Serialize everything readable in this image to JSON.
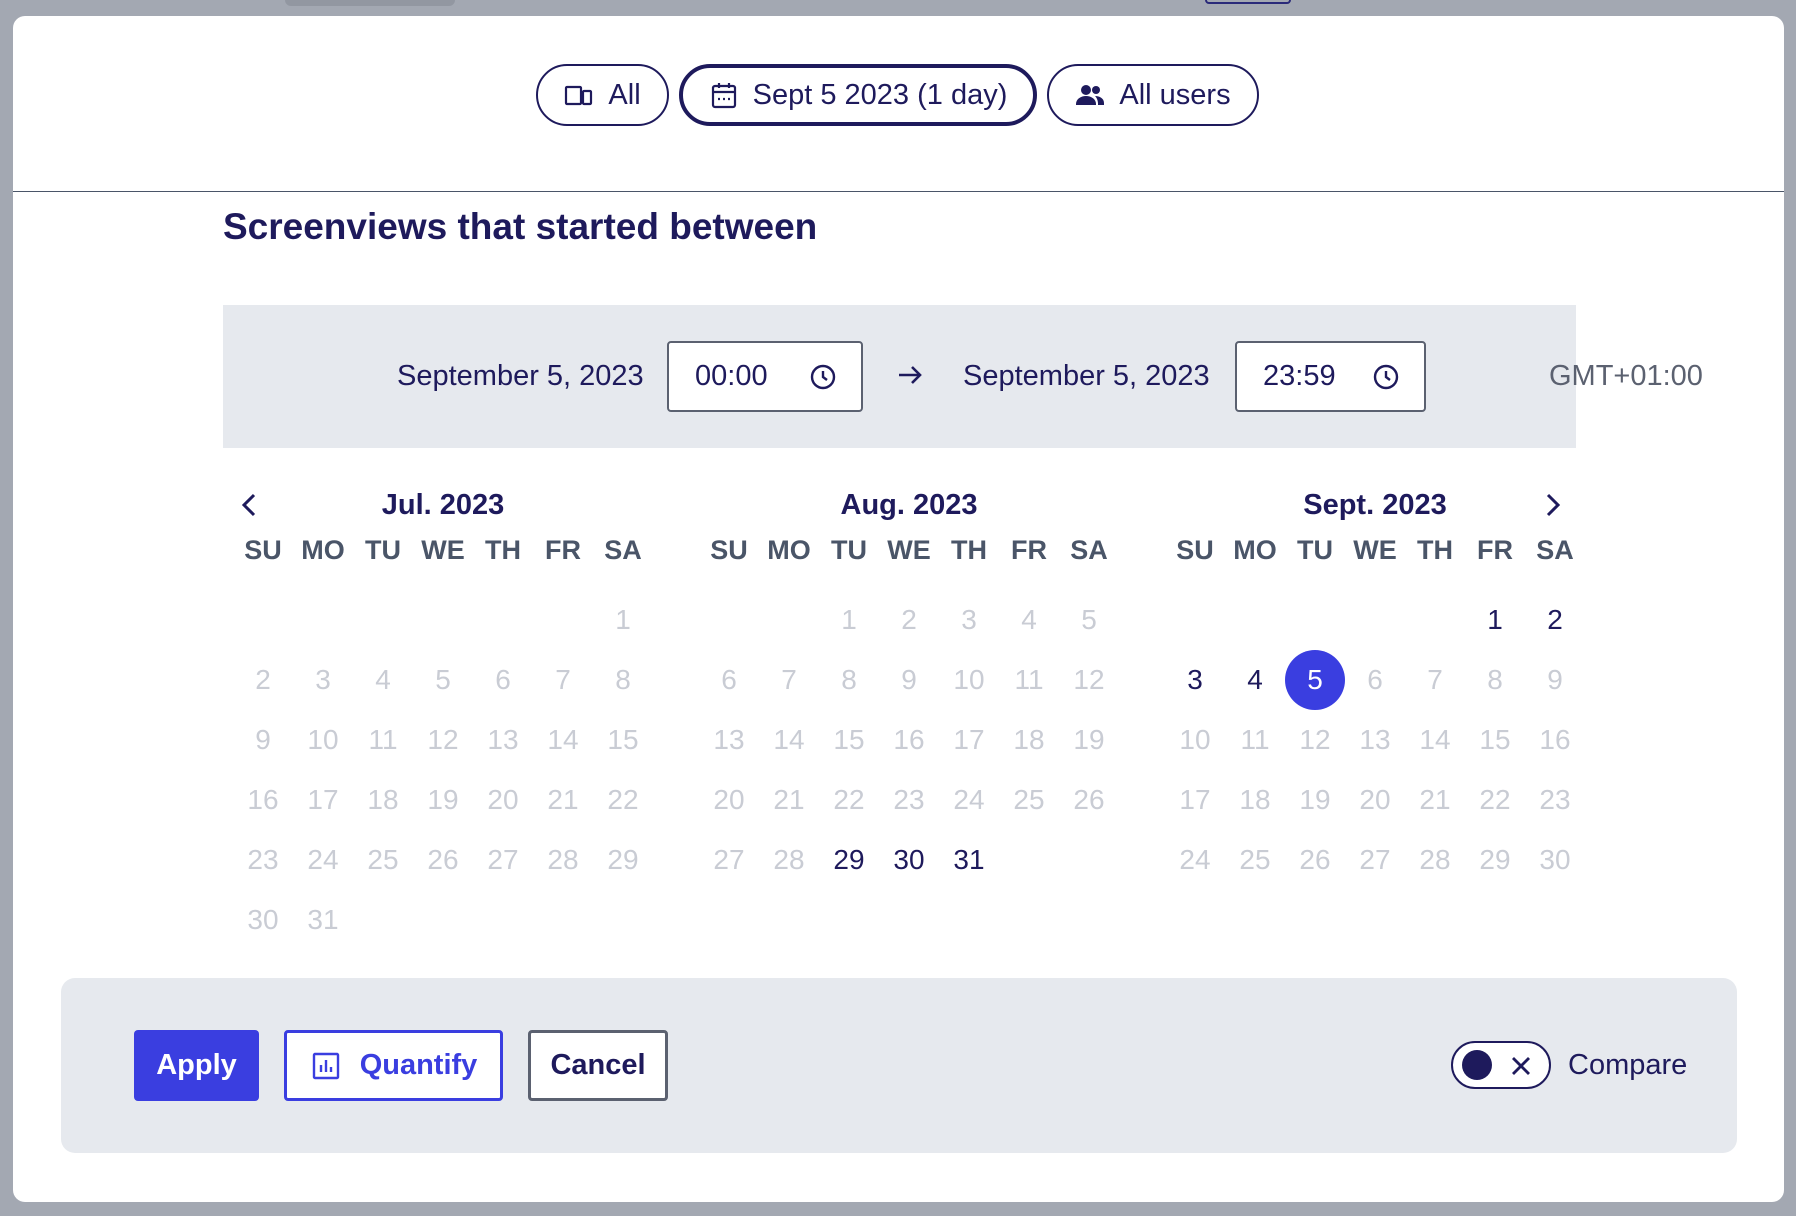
{
  "filters": {
    "device_label": "All",
    "date_label": "Sept 5 2023 (1 day)",
    "users_label": "All users"
  },
  "section_title": "Screenviews that started between",
  "range": {
    "start_date": "September 5, 2023",
    "start_time": "00:00",
    "end_date": "September 5, 2023",
    "end_time": "23:59",
    "timezone": "GMT+01:00"
  },
  "weekdays": [
    "SU",
    "MO",
    "TU",
    "WE",
    "TH",
    "FR",
    "SA"
  ],
  "months": [
    {
      "title": "Jul. 2023",
      "days": [
        {
          "label": "",
          "state": "empty"
        },
        {
          "label": "",
          "state": "empty"
        },
        {
          "label": "",
          "state": "empty"
        },
        {
          "label": "",
          "state": "empty"
        },
        {
          "label": "",
          "state": "empty"
        },
        {
          "label": "",
          "state": "empty"
        },
        {
          "label": "1",
          "state": "disabled"
        },
        {
          "label": "2",
          "state": "disabled"
        },
        {
          "label": "3",
          "state": "disabled"
        },
        {
          "label": "4",
          "state": "disabled"
        },
        {
          "label": "5",
          "state": "disabled"
        },
        {
          "label": "6",
          "state": "disabled"
        },
        {
          "label": "7",
          "state": "disabled"
        },
        {
          "label": "8",
          "state": "disabled"
        },
        {
          "label": "9",
          "state": "disabled"
        },
        {
          "label": "10",
          "state": "disabled"
        },
        {
          "label": "11",
          "state": "disabled"
        },
        {
          "label": "12",
          "state": "disabled"
        },
        {
          "label": "13",
          "state": "disabled"
        },
        {
          "label": "14",
          "state": "disabled"
        },
        {
          "label": "15",
          "state": "disabled"
        },
        {
          "label": "16",
          "state": "disabled"
        },
        {
          "label": "17",
          "state": "disabled"
        },
        {
          "label": "18",
          "state": "disabled"
        },
        {
          "label": "19",
          "state": "disabled"
        },
        {
          "label": "20",
          "state": "disabled"
        },
        {
          "label": "21",
          "state": "disabled"
        },
        {
          "label": "22",
          "state": "disabled"
        },
        {
          "label": "23",
          "state": "disabled"
        },
        {
          "label": "24",
          "state": "disabled"
        },
        {
          "label": "25",
          "state": "disabled"
        },
        {
          "label": "26",
          "state": "disabled"
        },
        {
          "label": "27",
          "state": "disabled"
        },
        {
          "label": "28",
          "state": "disabled"
        },
        {
          "label": "29",
          "state": "disabled"
        },
        {
          "label": "30",
          "state": "disabled"
        },
        {
          "label": "31",
          "state": "disabled"
        }
      ]
    },
    {
      "title": "Aug. 2023",
      "days": [
        {
          "label": "",
          "state": "empty"
        },
        {
          "label": "",
          "state": "empty"
        },
        {
          "label": "1",
          "state": "disabled"
        },
        {
          "label": "2",
          "state": "disabled"
        },
        {
          "label": "3",
          "state": "disabled"
        },
        {
          "label": "4",
          "state": "disabled"
        },
        {
          "label": "5",
          "state": "disabled"
        },
        {
          "label": "6",
          "state": "disabled"
        },
        {
          "label": "7",
          "state": "disabled"
        },
        {
          "label": "8",
          "state": "disabled"
        },
        {
          "label": "9",
          "state": "disabled"
        },
        {
          "label": "10",
          "state": "disabled"
        },
        {
          "label": "11",
          "state": "disabled"
        },
        {
          "label": "12",
          "state": "disabled"
        },
        {
          "label": "13",
          "state": "disabled"
        },
        {
          "label": "14",
          "state": "disabled"
        },
        {
          "label": "15",
          "state": "disabled"
        },
        {
          "label": "16",
          "state": "disabled"
        },
        {
          "label": "17",
          "state": "disabled"
        },
        {
          "label": "18",
          "state": "disabled"
        },
        {
          "label": "19",
          "state": "disabled"
        },
        {
          "label": "20",
          "state": "disabled"
        },
        {
          "label": "21",
          "state": "disabled"
        },
        {
          "label": "22",
          "state": "disabled"
        },
        {
          "label": "23",
          "state": "disabled"
        },
        {
          "label": "24",
          "state": "disabled"
        },
        {
          "label": "25",
          "state": "disabled"
        },
        {
          "label": "26",
          "state": "disabled"
        },
        {
          "label": "27",
          "state": "disabled"
        },
        {
          "label": "28",
          "state": "disabled"
        },
        {
          "label": "29",
          "state": "enabled"
        },
        {
          "label": "30",
          "state": "enabled"
        },
        {
          "label": "31",
          "state": "enabled"
        }
      ]
    },
    {
      "title": "Sept. 2023",
      "days": [
        {
          "label": "",
          "state": "empty"
        },
        {
          "label": "",
          "state": "empty"
        },
        {
          "label": "",
          "state": "empty"
        },
        {
          "label": "",
          "state": "empty"
        },
        {
          "label": "",
          "state": "empty"
        },
        {
          "label": "1",
          "state": "enabled"
        },
        {
          "label": "2",
          "state": "enabled"
        },
        {
          "label": "3",
          "state": "enabled"
        },
        {
          "label": "4",
          "state": "enabled"
        },
        {
          "label": "5",
          "state": "selected"
        },
        {
          "label": "6",
          "state": "disabled"
        },
        {
          "label": "7",
          "state": "disabled"
        },
        {
          "label": "8",
          "state": "disabled"
        },
        {
          "label": "9",
          "state": "disabled"
        },
        {
          "label": "10",
          "state": "disabled"
        },
        {
          "label": "11",
          "state": "disabled"
        },
        {
          "label": "12",
          "state": "disabled"
        },
        {
          "label": "13",
          "state": "disabled"
        },
        {
          "label": "14",
          "state": "disabled"
        },
        {
          "label": "15",
          "state": "disabled"
        },
        {
          "label": "16",
          "state": "disabled"
        },
        {
          "label": "17",
          "state": "disabled"
        },
        {
          "label": "18",
          "state": "disabled"
        },
        {
          "label": "19",
          "state": "disabled"
        },
        {
          "label": "20",
          "state": "disabled"
        },
        {
          "label": "21",
          "state": "disabled"
        },
        {
          "label": "22",
          "state": "disabled"
        },
        {
          "label": "23",
          "state": "disabled"
        },
        {
          "label": "24",
          "state": "disabled"
        },
        {
          "label": "25",
          "state": "disabled"
        },
        {
          "label": "26",
          "state": "disabled"
        },
        {
          "label": "27",
          "state": "disabled"
        },
        {
          "label": "28",
          "state": "disabled"
        },
        {
          "label": "29",
          "state": "disabled"
        },
        {
          "label": "30",
          "state": "disabled"
        }
      ]
    }
  ],
  "footer": {
    "apply_label": "Apply",
    "quantify_label": "Quantify",
    "cancel_label": "Cancel",
    "compare_label": "Compare",
    "compare_enabled": false
  },
  "icons": {
    "device": "devices-icon",
    "date": "calendar-icon",
    "users": "users-icon",
    "time": "clock-icon",
    "range_arrow": "arrow-right-icon",
    "prev": "chevron-left-icon",
    "next": "chevron-right-icon",
    "quantify": "bar-chart-icon",
    "toggle_off": "close-icon"
  },
  "colors": {
    "accent": "#3a3ee0",
    "text": "#1e1a5c",
    "muted": "#c9ccd4",
    "panel": "#e6e9ee"
  }
}
